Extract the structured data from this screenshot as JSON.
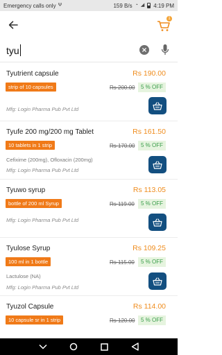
{
  "status_bar": {
    "left_text": "Emergency calls only",
    "usb_icon": "usb-icon",
    "speed": "159 B/s",
    "time": "4:19 PM"
  },
  "header": {
    "back_icon": "arrow-left-icon",
    "cart_icon": "cart-icon",
    "cart_count": "1"
  },
  "search": {
    "value": "tyu",
    "clear_icon": "close-circle-icon",
    "mic_icon": "mic-icon"
  },
  "colors": {
    "accent_orange": "#f07a18",
    "price_orange": "#ef8c1d",
    "discount_green": "#3a9d4a",
    "discount_bg": "#e6f4df",
    "button_navy": "#134f80"
  },
  "products": [
    {
      "name": "Tyutrient capsule",
      "price": "Rs 190.00",
      "pack": "strip of 10 capsules",
      "mrp": "Rs 200.00",
      "discount": "5 % OFF",
      "salt": "",
      "mfg": "Mfg: Login Pharma Pub Pvt Ltd"
    },
    {
      "name": "Tyufe 200 mg/200 mg Tablet",
      "price": "Rs 161.50",
      "pack": "10 tablets in 1 strip",
      "mrp": "Rs 170.00",
      "discount": "5 % OFF",
      "salt": "Cefixime (200mg), Ofloxacin (200mg)",
      "mfg": "Mfg: Login Pharma Pub Pvt Ltd"
    },
    {
      "name": "Tyuwo syrup",
      "price": "Rs 113.05",
      "pack": "bottle of 200 ml Syrup",
      "mrp": "Rs 119.00",
      "discount": "5 % OFF",
      "salt": "",
      "mfg": "Mfg: Login Pharma Pub Pvt Ltd"
    },
    {
      "name": "Tyulose Syrup",
      "price": "Rs 109.25",
      "pack": "100 ml in 1 bottle",
      "mrp": "Rs 115.00",
      "discount": "5 % OFF",
      "salt": "Lactulose (NA)",
      "mfg": "Mfg: Login Pharma Pub Pvt Ltd"
    },
    {
      "name": "Tyuzol Capsule",
      "price": "Rs 114.00",
      "pack": "10 capsule sr in 1 strip",
      "mrp": "Rs 120.00",
      "discount": "5 % OFF",
      "salt": "",
      "mfg": ""
    }
  ],
  "nav_bar": {
    "icons": [
      "nav-down-icon",
      "nav-home-icon",
      "nav-recents-icon",
      "nav-back-icon"
    ]
  }
}
